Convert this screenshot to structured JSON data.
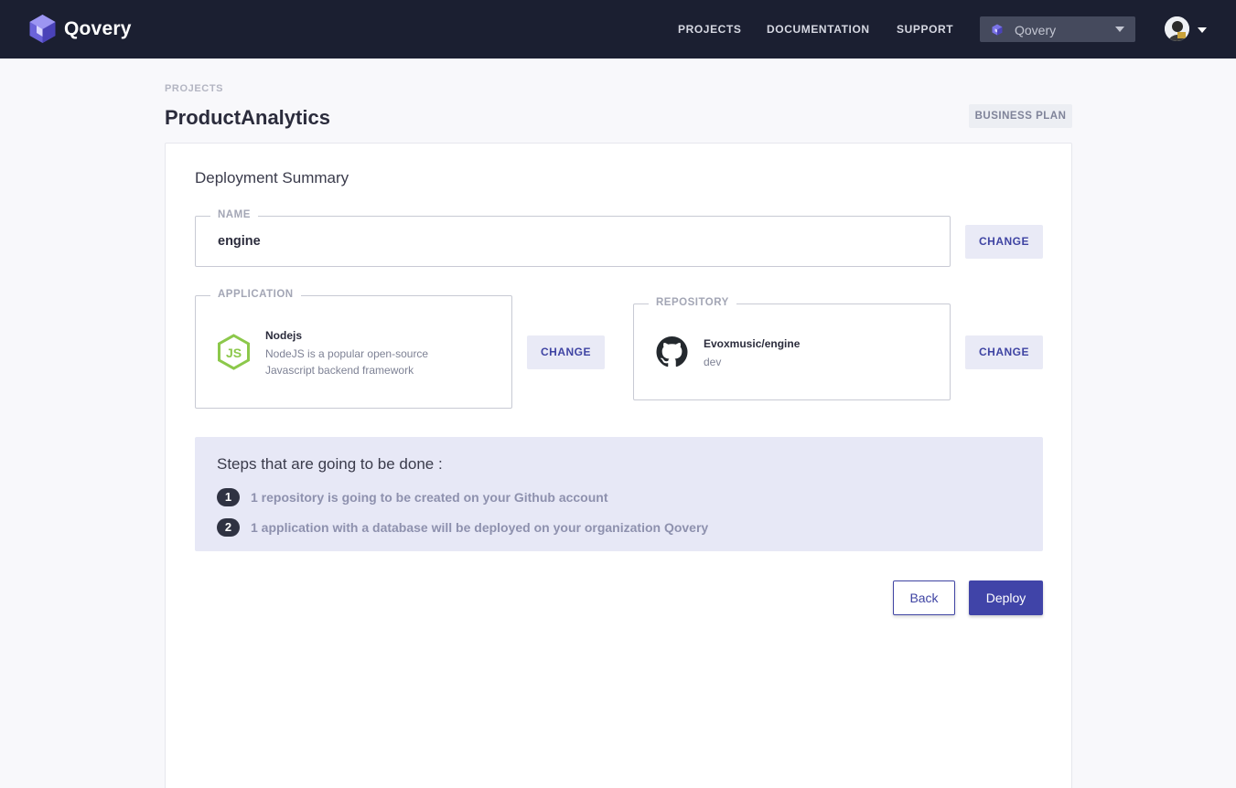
{
  "brand": {
    "name": "Qovery",
    "accent": "#4044a8",
    "topbar_bg": "#1b1f31"
  },
  "nav": {
    "links": [
      "PROJECTS",
      "DOCUMENTATION",
      "SUPPORT"
    ],
    "organization": {
      "selected": "Qovery"
    }
  },
  "page": {
    "breadcrumb": "PROJECTS",
    "title": "ProductAnalytics",
    "plan_badge": "BUSINESS PLAN"
  },
  "summary": {
    "title": "Deployment Summary",
    "name": {
      "label": "NAME",
      "value": "engine",
      "change_label": "CHANGE"
    },
    "application": {
      "label": "APPLICATION",
      "icon": "nodejs-icon",
      "title": "Nodejs",
      "description_line1": "NodeJS is a popular open-source",
      "description_line2": "Javascript backend framework",
      "change_label": "CHANGE"
    },
    "repository": {
      "label": "REPOSITORY",
      "icon": "github-icon",
      "title": "Evoxmusic/engine",
      "branch": "dev",
      "change_label": "CHANGE"
    },
    "steps": {
      "title": "Steps that are going to be done :",
      "items": [
        {
          "number": "1",
          "text": "1 repository is going to be created on your Github account"
        },
        {
          "number": "2",
          "text": "1 application with a database will be deployed on your organization Qovery"
        }
      ]
    },
    "actions": {
      "back_label": "Back",
      "deploy_label": "Deploy"
    }
  }
}
